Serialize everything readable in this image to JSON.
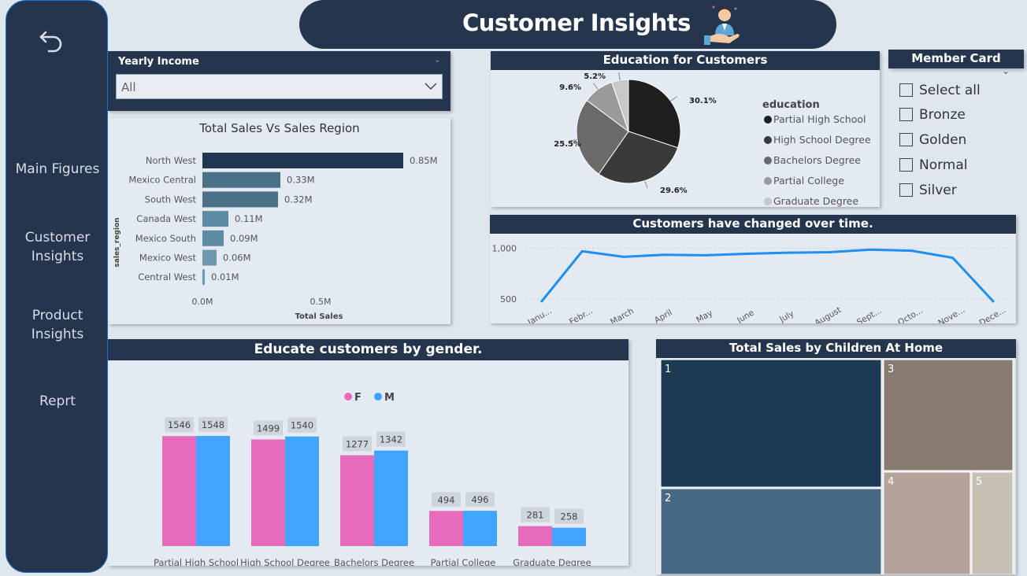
{
  "nav": {
    "back_icon": "back-arrow-icon",
    "items": [
      {
        "line1": "Main Figures",
        "line2": ""
      },
      {
        "line1": "Customer",
        "line2": "Insights"
      },
      {
        "line1": "Product",
        "line2": "Insights"
      },
      {
        "line1": "Reprt",
        "line2": ""
      }
    ]
  },
  "title": {
    "text": "Customer Insights",
    "icon": "customer-care-icon"
  },
  "income_slicer": {
    "label": "Yearly Income",
    "value": "All"
  },
  "member_card": {
    "title": "Member Card",
    "options": [
      "Select all",
      "Bronze",
      "Golden",
      "Normal",
      "Silver"
    ]
  },
  "colors": {
    "dark": "#25354d",
    "female": "#e66bbc",
    "male": "#41a5ff",
    "line": "#1f8ff2"
  },
  "chart_data": [
    {
      "type": "bar",
      "title": "Total Sales Vs Sales Region",
      "xlabel": "Total Sales",
      "ylabel": "sales_region",
      "categories": [
        "North West",
        "Mexico Central",
        "South West",
        "Canada West",
        "Mexico South",
        "Mexico West",
        "Central West"
      ],
      "values": [
        0.85,
        0.33,
        0.32,
        0.11,
        0.09,
        0.06,
        0.01
      ],
      "value_labels": [
        "0.85M",
        "0.33M",
        "0.32M",
        "0.11M",
        "0.09M",
        "0.06M",
        "0.01M"
      ],
      "xticks": [
        "0.0M",
        "0.5M"
      ],
      "xlim": [
        0,
        1.0
      ]
    },
    {
      "type": "pie",
      "title": "Education for Customers",
      "legend_title": "education",
      "legend_position": "right",
      "labels": [
        "Partial High School",
        "High School Degree",
        "Bachelors Degree",
        "Partial College",
        "Graduate Degree"
      ],
      "values": [
        30.1,
        29.6,
        25.5,
        9.6,
        5.2
      ],
      "value_labels": [
        "30.1%",
        "29.6%",
        "25.5%",
        "9.6%",
        "5.2%"
      ],
      "colors": [
        "#1f1f1f",
        "#3a3a3a",
        "#6a6a6a",
        "#9a9a9a",
        "#c8c8c8"
      ]
    },
    {
      "type": "line",
      "title": "Customers have changed over time.",
      "categories": [
        "Janu...",
        "Febr...",
        "March",
        "April",
        "May",
        "June",
        "July",
        "August",
        "Sept...",
        "Octo...",
        "Nove...",
        "Dece..."
      ],
      "values": [
        470,
        970,
        915,
        935,
        930,
        945,
        955,
        960,
        985,
        975,
        905,
        470
      ],
      "yticks": [
        "1,000",
        "500"
      ],
      "ytick_values": [
        1000,
        500
      ],
      "ylim": [
        400,
        1080
      ]
    },
    {
      "type": "bar",
      "title": "Educate customers by gender.",
      "categories": [
        "Partial High School",
        "High School Degree",
        "Bachelors Degree",
        "Partial College",
        "Graduate Degree"
      ],
      "series": [
        {
          "name": "F",
          "values": [
            1546,
            1499,
            1277,
            494,
            281
          ]
        },
        {
          "name": "M",
          "values": [
            1548,
            1540,
            1342,
            496,
            258
          ]
        }
      ],
      "legend_position": "top"
    },
    {
      "type": "treemap",
      "title": "Total Sales by Children At Home",
      "labels": [
        "1",
        "2",
        "3",
        "4",
        "5"
      ]
    }
  ]
}
